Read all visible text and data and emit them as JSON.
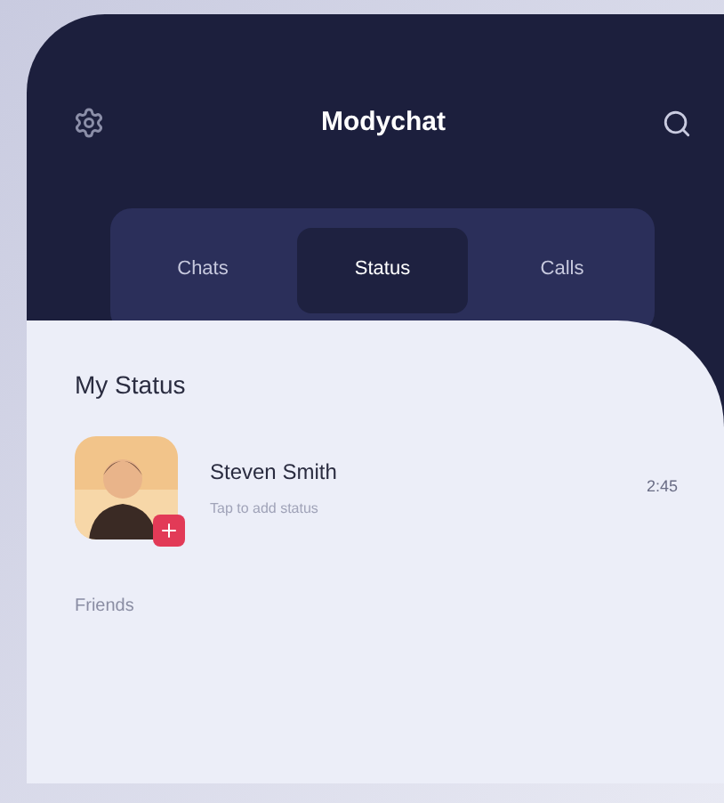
{
  "header": {
    "title": "Modychat"
  },
  "tabs": [
    {
      "label": "Chats",
      "selected": false
    },
    {
      "label": "Status",
      "selected": true
    },
    {
      "label": "Calls",
      "selected": false
    }
  ],
  "my_status": {
    "heading": "My Status",
    "name": "Steven Smith",
    "subtitle": "Tap to add status",
    "time": "2:45"
  },
  "friends": {
    "heading": "Friends"
  }
}
